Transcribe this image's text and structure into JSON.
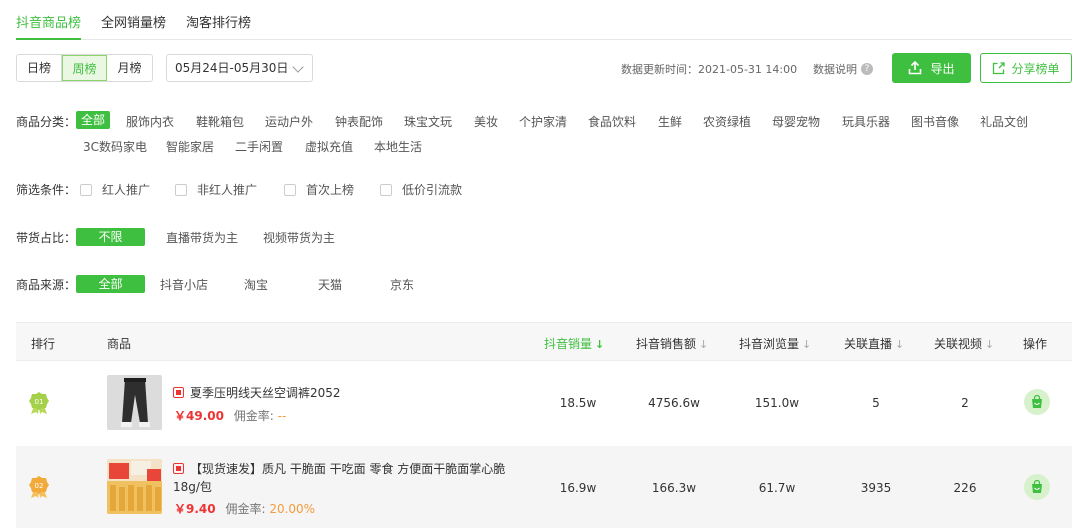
{
  "tabs": [
    "抖音商品榜",
    "全网销量榜",
    "淘客排行榜"
  ],
  "period_buttons": [
    "日榜",
    "周榜",
    "月榜"
  ],
  "date_range": "05月24日-05月30日",
  "update_time": "数据更新时间：2021-05-31 14:00",
  "data_explain": "数据说明",
  "export_label": "导出",
  "share_label": "分享榜单",
  "category": {
    "label": "商品分类：",
    "items_row1": [
      "全部",
      "服饰内衣",
      "鞋靴箱包",
      "运动户外",
      "钟表配饰",
      "珠宝文玩",
      "美妆",
      "个护家清",
      "食品饮料",
      "生鲜",
      "农资绿植",
      "母婴宠物",
      "玩具乐器",
      "图书音像",
      "礼品文创"
    ],
    "items_row2": [
      "3C数码家电",
      "智能家居",
      "二手闲置",
      "虚拟充值",
      "本地生活"
    ]
  },
  "screen": {
    "label": "筛选条件：",
    "items": [
      "红人推广",
      "非红人推广",
      "首次上榜",
      "低价引流款"
    ]
  },
  "ratio": {
    "label": "带货占比：",
    "items": [
      "不限",
      "直播带货为主",
      "视频带货为主"
    ]
  },
  "source": {
    "label": "商品来源：",
    "items": [
      "全部",
      "抖音小店",
      "淘宝",
      "天猫",
      "京东"
    ]
  },
  "table": {
    "headers": [
      "排行",
      "商品",
      "抖音销量",
      "抖音销售额",
      "抖音浏览量",
      "关联直播",
      "关联视频",
      "操作"
    ],
    "rows": [
      {
        "rank": "01",
        "title": "夏季压明线天丝空调裤2052",
        "price": "￥49.00",
        "commission_label": "佣金率:",
        "commission": "--",
        "sales": "18.5w",
        "revenue": "4756.6w",
        "views": "151.0w",
        "live": "5",
        "video": "2"
      },
      {
        "rank": "02",
        "title": "【现货速发】质凡 干脆面 干吃面 零食 方便面干脆面掌心脆18g/包",
        "price": "￥9.40",
        "commission_label": "佣金率:",
        "commission": "20.00%",
        "sales": "16.9w",
        "revenue": "166.3w",
        "views": "61.7w",
        "live": "3935",
        "video": "226"
      }
    ]
  },
  "colors": {
    "accent": "#3fbf3f",
    "price": "#e33333",
    "commission": "#f39c3c"
  }
}
